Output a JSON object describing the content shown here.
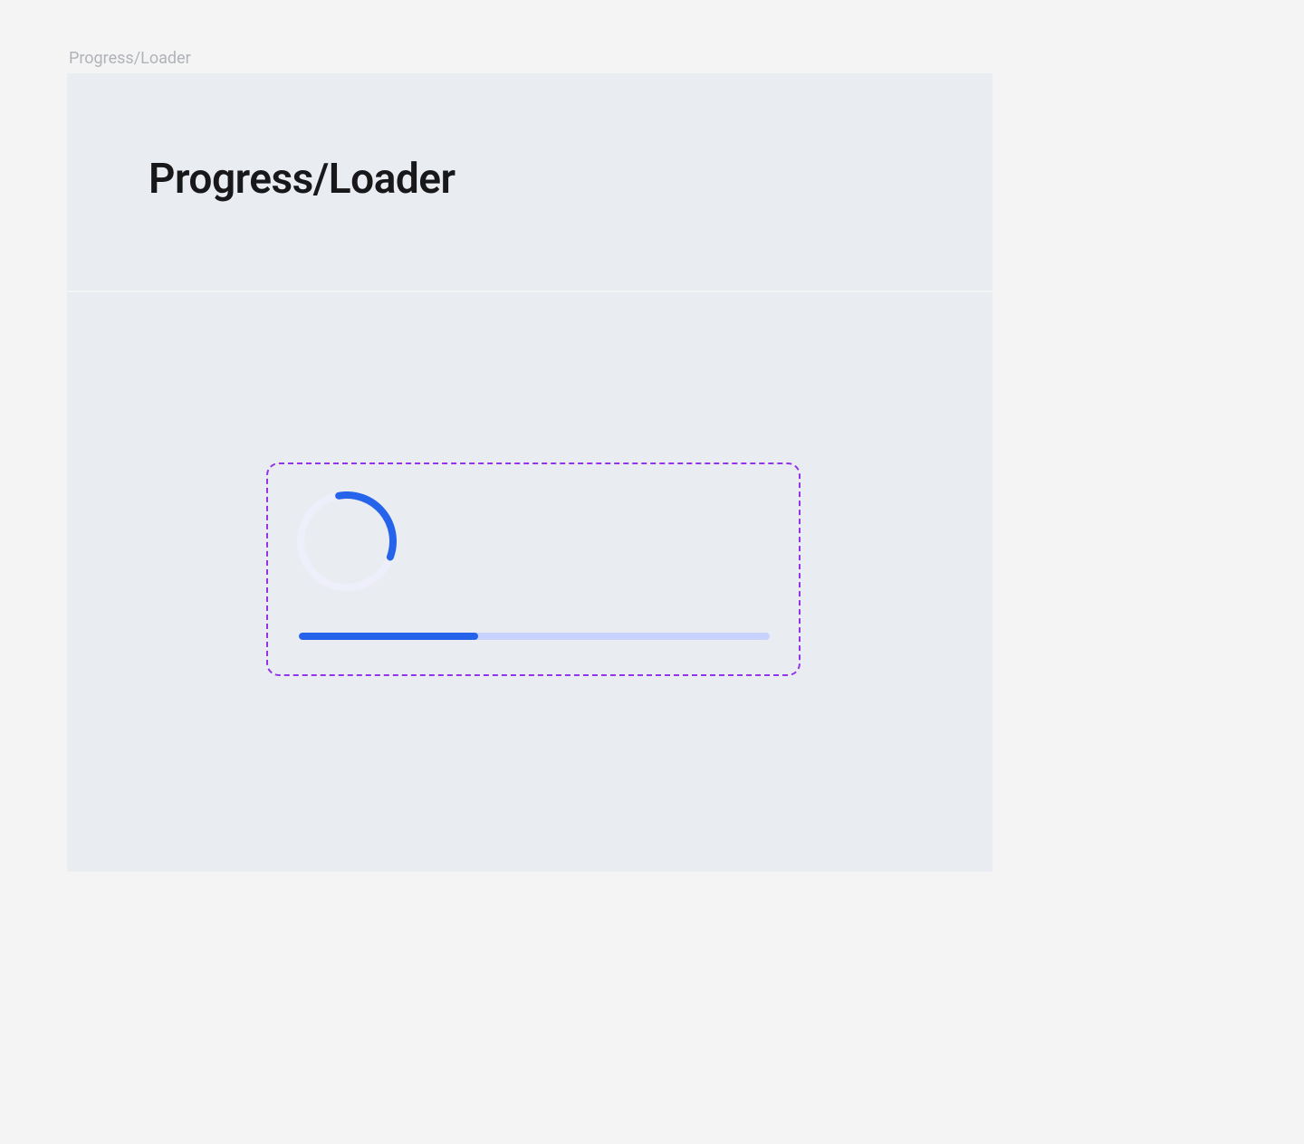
{
  "breadcrumb": {
    "label": "Progress/Loader"
  },
  "page": {
    "title": "Progress/Loader"
  },
  "spinner": {
    "track_color": "#efeffb",
    "arc_color": "#2563eb",
    "arc_start_deg": -10,
    "arc_sweep_deg": 120
  },
  "progress": {
    "percent": 38,
    "track_color": "#c7d2fe",
    "fill_color": "#2563eb"
  },
  "frame": {
    "border_color": "#9333ea"
  }
}
